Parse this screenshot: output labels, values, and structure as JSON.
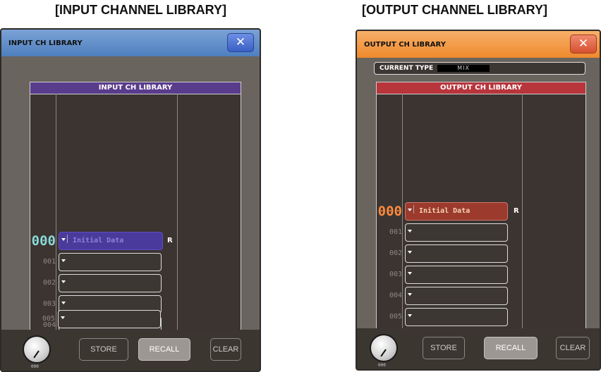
{
  "captions": {
    "left": "[INPUT CHANNEL LIBRARY]",
    "right": "[OUTPUT CHANNEL LIBRARY]"
  },
  "input": {
    "window_title": "INPUT CH LIBRARY",
    "close_label": "✕",
    "list_header": "INPUT CH LIBRARY",
    "rows": [
      {
        "num": "000",
        "name": "Initial Data",
        "read_only": "R"
      },
      {
        "num": "001",
        "name": ""
      },
      {
        "num": "002",
        "name": ""
      },
      {
        "num": "003",
        "name": ""
      },
      {
        "num": "004",
        "name": ""
      },
      {
        "num": "005",
        "name": ""
      }
    ],
    "knob_value": "000",
    "buttons": {
      "store": "STORE",
      "recall": "RECALL",
      "clear": "CLEAR"
    }
  },
  "output": {
    "window_title": "OUTPUT CH LIBRARY",
    "close_label": "✕",
    "current_type_label": "CURRENT TYPE",
    "current_type_value": "MIX",
    "list_header": "OUTPUT CH LIBRARY",
    "rows": [
      {
        "num": "000",
        "name": "Initial Data",
        "read_only": "R"
      },
      {
        "num": "001",
        "name": ""
      },
      {
        "num": "002",
        "name": ""
      },
      {
        "num": "003",
        "name": ""
      },
      {
        "num": "004",
        "name": ""
      },
      {
        "num": "005",
        "name": ""
      }
    ],
    "knob_value": "000",
    "buttons": {
      "store": "STORE",
      "recall": "RECALL",
      "clear": "CLEAR"
    }
  }
}
